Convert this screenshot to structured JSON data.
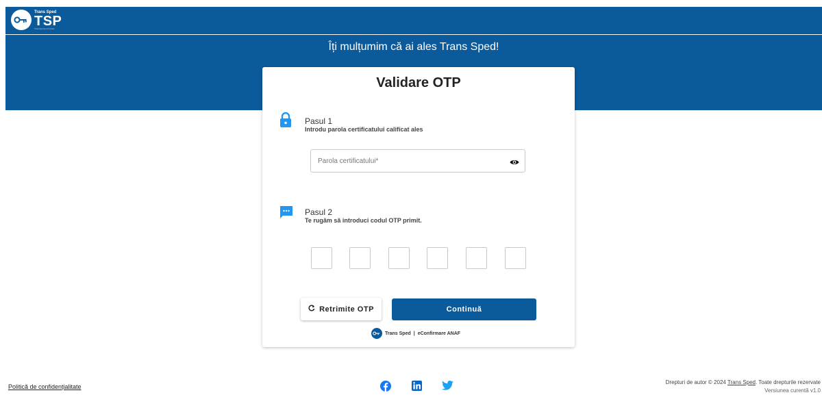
{
  "header": {
    "logo_small": "Trans Sped",
    "logo_big": "TSP",
    "logo_tiny": "Trust Service Provider"
  },
  "hero": {
    "title": "Îți mulțumim că ai ales Trans Sped!"
  },
  "card": {
    "title": "Validare OTP",
    "step1": {
      "title": "Pasul 1",
      "subtitle": "Introdu parola certificatului calificat ales",
      "password_placeholder": "Parola certificatului*",
      "password_value": ""
    },
    "step2": {
      "title": "Pasul 2",
      "subtitle": "Te rugăm să introduci codul OTP primit.",
      "otp_values": [
        "",
        "",
        "",
        "",
        "",
        ""
      ]
    },
    "resend_label": "Retrimite OTP",
    "continue_label": "Continuă",
    "footer_brand": "Trans Sped",
    "footer_sep": "|",
    "footer_service": "eConfirmare ANAF"
  },
  "footer": {
    "privacy_link": "Politică de confidențialitate",
    "copyright_prefix": "Drepturi de autor © 2024",
    "copyright_link": "Trans Sped",
    "copyright_suffix": ". Toate drepturile rezervate",
    "version": "Versiunea curentă v1.0"
  },
  "colors": {
    "brand": "#0a5a9c",
    "icon_blue": "#2196f3",
    "facebook": "#1877f2",
    "linkedin": "#0a66c2",
    "twitter": "#1da1f2"
  },
  "icons": [
    "key-icon",
    "lock-icon",
    "chat-icon",
    "eye-icon",
    "refresh-icon",
    "facebook-icon",
    "linkedin-icon",
    "twitter-icon"
  ]
}
